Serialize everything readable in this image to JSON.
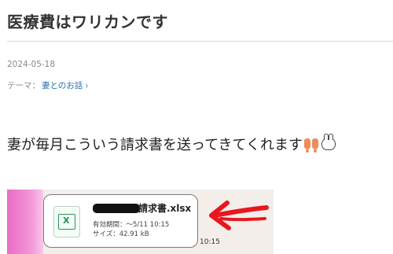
{
  "post": {
    "title": "医療費はワリカンです",
    "date": "2024-05-18",
    "theme_prefix": "テーマ：",
    "theme_link": "妻とのお話",
    "body_text": "妻が毎月こういう請求書を送ってきてくれます"
  },
  "attachment": {
    "file_name": "請求書.xlsx",
    "expiry": "有効期間：～5/11 10:15",
    "size": "サイズ：42.91 kB",
    "time": "10:15",
    "icon": "spreadsheet-file-icon",
    "icon_letter": "X"
  },
  "colors": {
    "link": "#2a6eb4",
    "arrow": "#e8171f",
    "excel_green": "#2f8f5b",
    "pink": "#e96cc7"
  }
}
